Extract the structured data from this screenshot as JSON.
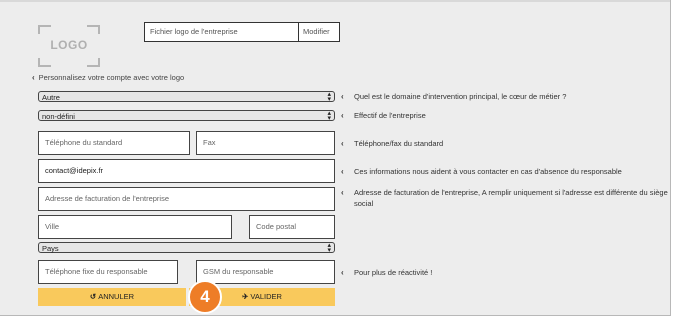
{
  "logo": {
    "placeholder_text": "LOGO"
  },
  "logo_file": {
    "placeholder": "Fichier logo de l'entreprise",
    "button_label": "Modifier"
  },
  "logo_hint": "Personnalisez votre compte avec votre logo",
  "domain_select": {
    "value": "Autre",
    "help": "Quel est le domaine d'intervention principal, le cœur de métier ?"
  },
  "staff_select": {
    "value": "non-défini",
    "help": "Effectif de l'entreprise"
  },
  "phone": {
    "placeholder": "Téléphone du standard"
  },
  "fax": {
    "placeholder": "Fax"
  },
  "phone_help": "Téléphone/fax du standard",
  "email": {
    "value": "contact@idepix.fr",
    "help": "Ces informations nous aident à vous contacter en cas d'absence du responsable"
  },
  "billing_address": {
    "placeholder": "Adresse de facturation de l'entreprise",
    "help": "Adresse de facturation de l'entreprise, A remplir uniquement si l'adresse est différente du siège social"
  },
  "city": {
    "placeholder": "Ville"
  },
  "postal_code": {
    "placeholder": "Code postal"
  },
  "country_select": {
    "value": "Pays"
  },
  "manager_phone": {
    "placeholder": "Téléphone fixe du responsable"
  },
  "manager_gsm": {
    "placeholder": "GSM du responsable"
  },
  "manager_help": "Pour plus de réactivité !",
  "actions": {
    "cancel_label": "ANNULER",
    "validate_label": "VALIDER"
  },
  "step_badge": "4",
  "colors": {
    "button_bg": "#f9c95c",
    "badge_bg": "#ee7d27",
    "panel_bg": "#ededed"
  },
  "icons": {
    "cancel": "undo-icon",
    "validate": "send-icon",
    "help": "chevron-left-icon"
  }
}
